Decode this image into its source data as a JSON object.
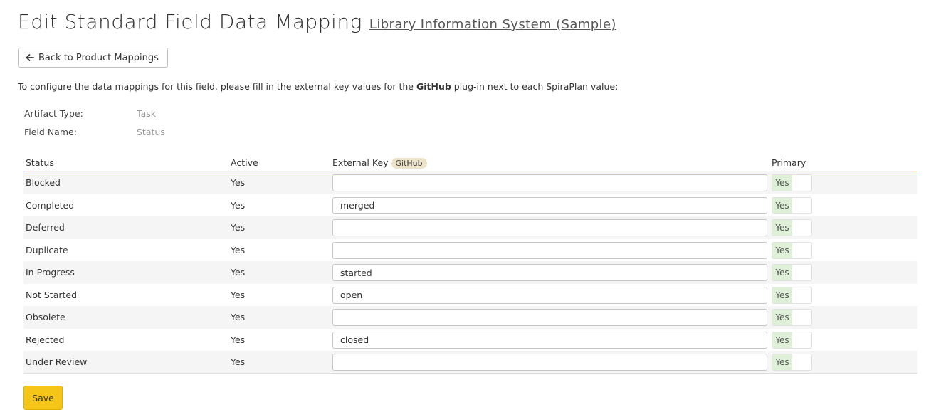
{
  "header": {
    "title": "Edit Standard Field Data Mapping",
    "product_link": "Library Information System (Sample)"
  },
  "toolbar": {
    "back_label": "Back to Product Mappings",
    "back_icon": "arrow-left-icon"
  },
  "instructions": {
    "before": "To configure the data mappings for this field, please fill in the external key values for the ",
    "plugin": "GitHub",
    "after": " plug-in next to each SpiraPlan value:"
  },
  "meta": {
    "artifact_label": "Artifact Type:",
    "artifact_value": "Task",
    "field_label": "Field Name:",
    "field_value": "Status"
  },
  "grid": {
    "headers": {
      "status": "Status",
      "active": "Active",
      "external_key": "External Key",
      "external_key_badge": "GitHub",
      "primary": "Primary"
    },
    "rows": [
      {
        "status": "Blocked",
        "active": "Yes",
        "key": "",
        "primary": "Yes"
      },
      {
        "status": "Completed",
        "active": "Yes",
        "key": "merged",
        "primary": "Yes"
      },
      {
        "status": "Deferred",
        "active": "Yes",
        "key": "",
        "primary": "Yes"
      },
      {
        "status": "Duplicate",
        "active": "Yes",
        "key": "",
        "primary": "Yes"
      },
      {
        "status": "In Progress",
        "active": "Yes",
        "key": "started",
        "primary": "Yes"
      },
      {
        "status": "Not Started",
        "active": "Yes",
        "key": "open",
        "primary": "Yes"
      },
      {
        "status": "Obsolete",
        "active": "Yes",
        "key": "",
        "primary": "Yes"
      },
      {
        "status": "Rejected",
        "active": "Yes",
        "key": "closed",
        "primary": "Yes"
      },
      {
        "status": "Under Review",
        "active": "Yes",
        "key": "",
        "primary": "Yes"
      }
    ]
  },
  "actions": {
    "save_label": "Save"
  },
  "colors": {
    "accent": "#f5c518",
    "toggle_on": "#dff0d8",
    "row_alt": "#f5f5f5"
  }
}
